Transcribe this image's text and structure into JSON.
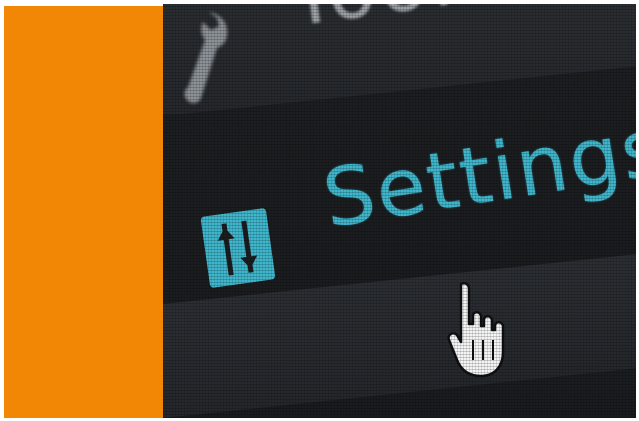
{
  "menu": {
    "tools_label": "Tools",
    "settings_label": "Settings"
  },
  "icons": {
    "tools": "wrench-icon",
    "settings": "sliders-icon",
    "pointer": "hand-cursor-icon"
  },
  "colors": {
    "accent_panel": "#f28705",
    "settings_text": "#3fb6cc",
    "tools_text": "#9da3a8",
    "screen_background": "#1d2024"
  }
}
